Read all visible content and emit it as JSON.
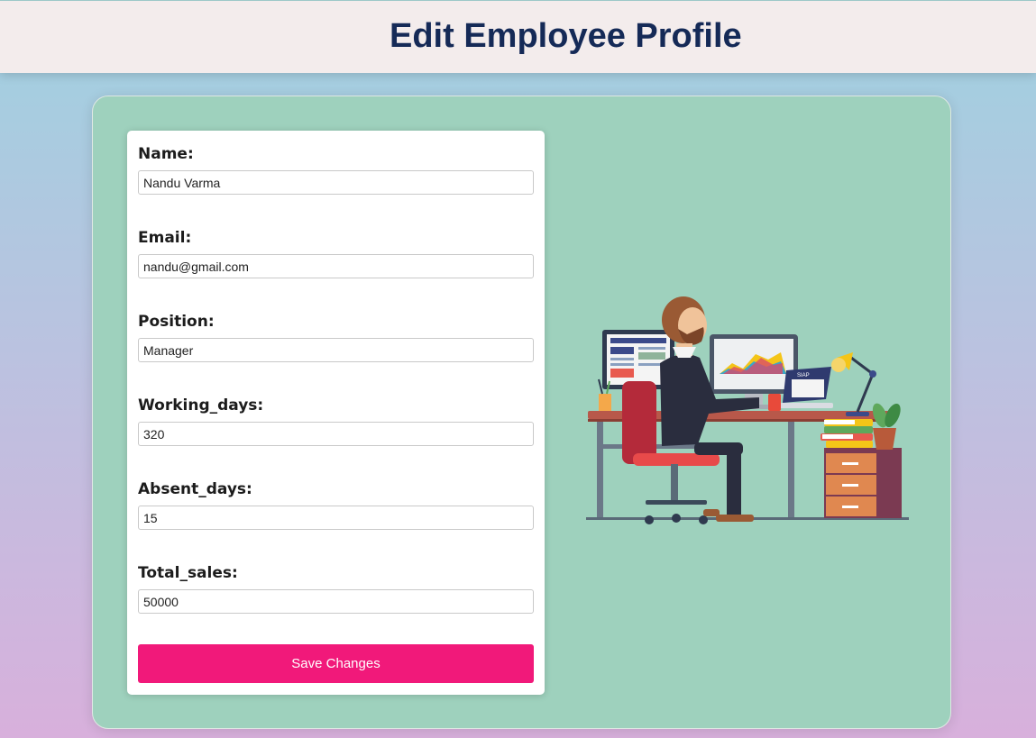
{
  "header": {
    "title": "Edit Employee Profile"
  },
  "form": {
    "fields": [
      {
        "label": "Name:",
        "value": "Nandu Varma"
      },
      {
        "label": "Email:",
        "value": "nandu@gmail.com"
      },
      {
        "label": "Position:",
        "value": "Manager"
      },
      {
        "label": "Working_days:",
        "value": "320"
      },
      {
        "label": "Absent_days:",
        "value": "15"
      },
      {
        "label": "Total_sales:",
        "value": "50000"
      }
    ],
    "save_label": "Save Changes"
  },
  "illustration": {
    "icon": "employee-at-desk-illustration",
    "badge_text": "SIAP"
  },
  "colors": {
    "header_bg": "#f3ecec",
    "title": "#152a57",
    "card_bg": "#9ed1bd",
    "button_bg": "#f1197a"
  }
}
